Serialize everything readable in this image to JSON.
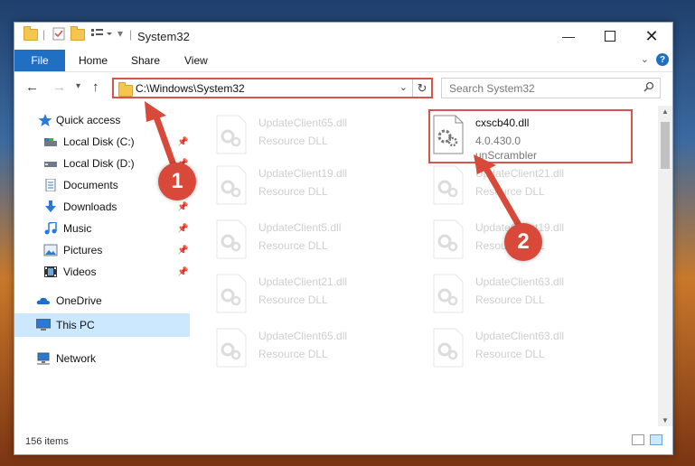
{
  "window": {
    "title": "System32"
  },
  "ribbon": {
    "file": "File",
    "home": "Home",
    "share": "Share",
    "view": "View",
    "help": "?"
  },
  "address": {
    "path": "C:\\Windows\\System32"
  },
  "search": {
    "placeholder": "Search System32"
  },
  "sidebar": {
    "items": [
      {
        "label": "Quick access",
        "icon": "star-icon",
        "pinned": false
      },
      {
        "label": "Local Disk (C:)",
        "icon": "drive-icon",
        "pinned": true
      },
      {
        "label": "Local Disk (D:)",
        "icon": "drive-icon",
        "pinned": true
      },
      {
        "label": "Documents",
        "icon": "documents-icon",
        "pinned": true
      },
      {
        "label": "Downloads",
        "icon": "download-icon",
        "pinned": true
      },
      {
        "label": "Music",
        "icon": "music-icon",
        "pinned": true
      },
      {
        "label": "Pictures",
        "icon": "pictures-icon",
        "pinned": true
      },
      {
        "label": "Videos",
        "icon": "videos-icon",
        "pinned": true
      },
      {
        "label": "OneDrive",
        "icon": "cloud-icon",
        "pinned": false
      },
      {
        "label": "This PC",
        "icon": "computer-icon",
        "pinned": false,
        "selected": true
      },
      {
        "label": "Network",
        "icon": "network-icon",
        "pinned": false
      }
    ]
  },
  "files": [
    {
      "name": "UpdateClient65.dll",
      "type": "Resource DLL"
    },
    {
      "name": "cxscb40.dll",
      "version": "4.0.430.0",
      "description": "unScrambler"
    },
    {
      "name": "UpdateClient19.dll",
      "type": "Resource DLL"
    },
    {
      "name": "UpdateClient21.dll",
      "type": "Resource DLL"
    },
    {
      "name": "UpdateClient5.dll",
      "type": "Resource DLL"
    },
    {
      "name": "UpdateClient19.dll",
      "type": "Resource DLL"
    },
    {
      "name": "UpdateClient21.dll",
      "type": "Resource DLL"
    },
    {
      "name": "UpdateClient63.dll",
      "type": "Resource DLL"
    },
    {
      "name": "UpdateClient65.dll",
      "type": "Resource DLL"
    },
    {
      "name": "UpdateClient63.dll",
      "type": "Resource DLL"
    }
  ],
  "status": {
    "count": "156 items"
  },
  "annotations": {
    "step1": "1",
    "step2": "2"
  },
  "colors": {
    "accent": "#1f6fc4",
    "highlight": "#d9534f",
    "badge": "#d8493a"
  }
}
